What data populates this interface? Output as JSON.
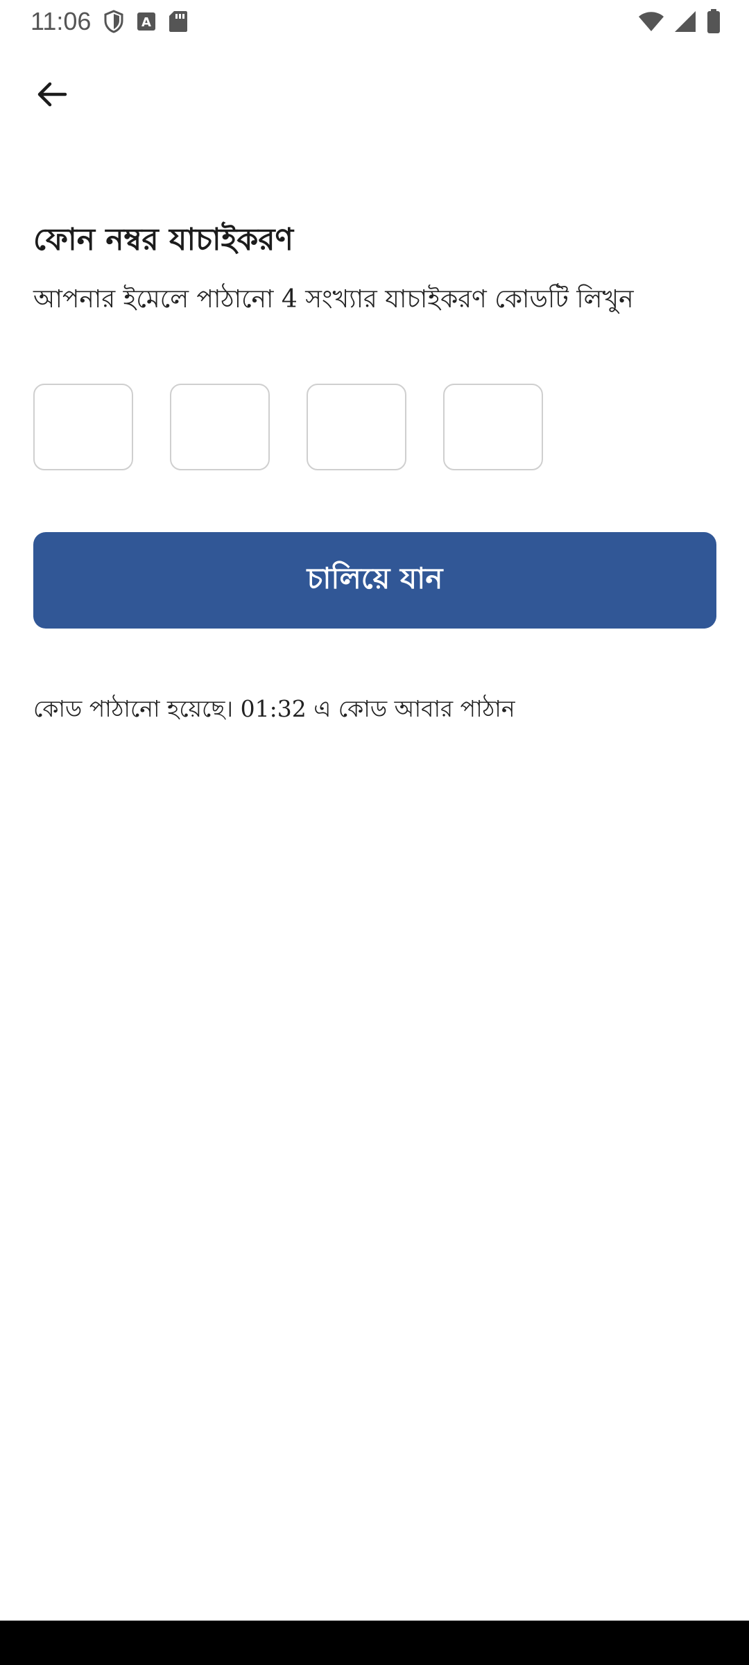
{
  "status_bar": {
    "time": "11:06",
    "left_icons": [
      "shield-icon",
      "a-box-icon",
      "sd-card-icon"
    ],
    "right_icons": [
      "wifi-icon",
      "signal-icon",
      "battery-icon"
    ]
  },
  "header": {
    "back_icon": "arrow-left-icon"
  },
  "main": {
    "title": "ফোন নম্বর যাচাইকরণ",
    "subtitle": "আপনার ইমেলে পাঠানো 4 সংখ্যার যাচাইকরণ কোডটি লিখুন",
    "otp": {
      "length": 4,
      "values": [
        "",
        "",
        "",
        ""
      ]
    },
    "continue_label": "চালিয়ে যান",
    "resend_text": "কোড পাঠানো হয়েছে। 01:32 এ কোড আবার পাঠান"
  },
  "colors": {
    "primary_button": "#315796",
    "otp_border": "#cfcfcf",
    "nav_bar": "#000000"
  }
}
